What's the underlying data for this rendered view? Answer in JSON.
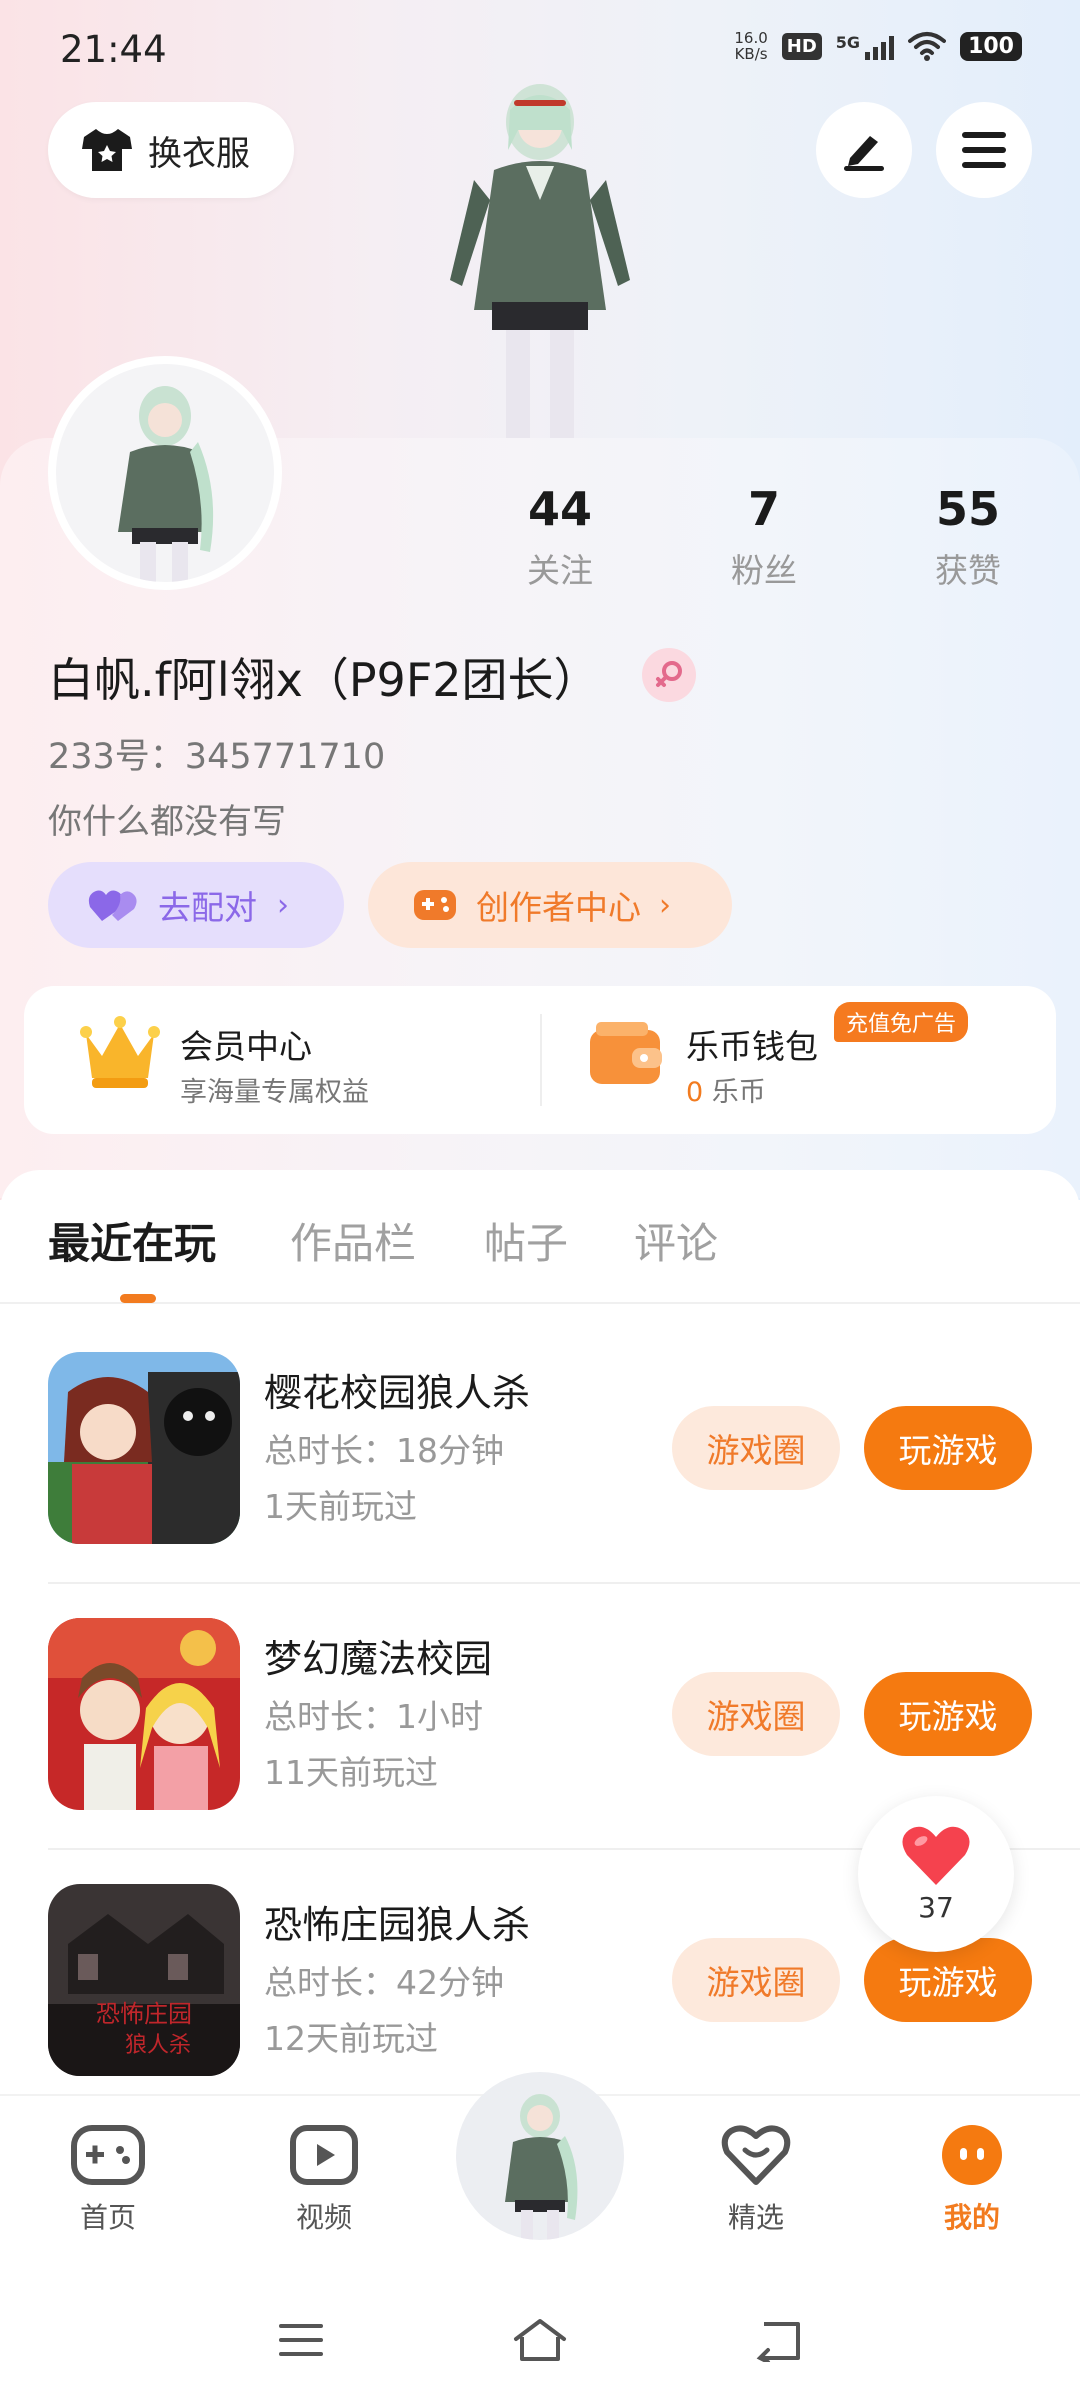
{
  "status_bar": {
    "time": "21:44",
    "net_speed_value": "16.0",
    "net_speed_unit": "KB/s",
    "hd": "HD",
    "network": "5G",
    "battery": "100"
  },
  "header": {
    "outfit_label": "换衣服"
  },
  "profile": {
    "stats": [
      {
        "value": "44",
        "label": "关注"
      },
      {
        "value": "7",
        "label": "粉丝"
      },
      {
        "value": "55",
        "label": "获赞"
      }
    ],
    "username": "白帆.f阿l翎x（P9F2团长）",
    "uid": "233号：345771710",
    "bio": "你什么都没有写",
    "pair_label": "去配对",
    "creator_label": "创作者中心"
  },
  "member_card": {
    "member_title": "会员中心",
    "member_sub": "享海量专属权益",
    "wallet_title": "乐币钱包",
    "wallet_amount": "0",
    "wallet_unit": "乐币",
    "ad_badge": "充值免广告"
  },
  "tabs": [
    "最近在玩",
    "作品栏",
    "帖子",
    "评论"
  ],
  "games": [
    {
      "title": "樱花校园狼人杀",
      "duration": "总时长：18分钟",
      "last_played": "1天前玩过",
      "circle_label": "游戏圈",
      "play_label": "玩游戏"
    },
    {
      "title": "梦幻魔法校园",
      "duration": "总时长：1小时",
      "last_played": "11天前玩过",
      "circle_label": "游戏圈",
      "play_label": "玩游戏"
    },
    {
      "title": "恐怖庄园狼人杀",
      "duration": "总时长：42分钟",
      "last_played": "12天前玩过",
      "circle_label": "游戏圈",
      "play_label": "玩游戏"
    }
  ],
  "like_float": {
    "count": "37"
  },
  "bottom_nav": [
    {
      "label": "首页",
      "icon": "gamepad-icon"
    },
    {
      "label": "视频",
      "icon": "video-icon"
    },
    {
      "label": "精选",
      "icon": "heart-smile-icon"
    },
    {
      "label": "我的",
      "icon": "face-icon"
    }
  ],
  "colors": {
    "accent": "#f57a10",
    "pair_purple": "#8b68e8"
  }
}
